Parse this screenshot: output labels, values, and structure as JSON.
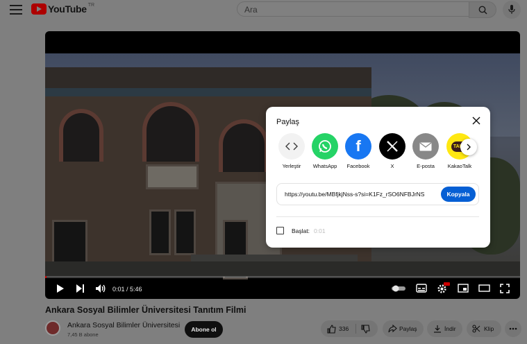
{
  "header": {
    "logo_text": "YouTube",
    "country_code": "TR",
    "search_placeholder": "Ara"
  },
  "player": {
    "time_display": "0:01 / 5:46",
    "progress_fraction": 0.003
  },
  "share_dialog": {
    "title": "Paylaş",
    "items": [
      {
        "label": "Yerleştir",
        "icon": "embed-icon",
        "color": "#f2f2f2"
      },
      {
        "label": "WhatsApp",
        "icon": "whatsapp-icon",
        "color": "#25d366"
      },
      {
        "label": "Facebook",
        "icon": "facebook-icon",
        "color": "#1877f2"
      },
      {
        "label": "X",
        "icon": "x-icon",
        "color": "#000000"
      },
      {
        "label": "E-posta",
        "icon": "email-icon",
        "color": "#888888"
      },
      {
        "label": "KakaoTalk",
        "icon": "kakaotalk-icon",
        "color": "#ffe812"
      }
    ],
    "kakao_badge": "TALK",
    "link": "https://youtu.be/MBfjkjNss-s?si=K1Fz_rSO6NFBJrNS",
    "copy_label": "Kopyala",
    "start_label": "Başlat:",
    "start_time": "0:01"
  },
  "video": {
    "title": "Ankara Sosyal Bilimler Üniversitesi Tanıtım Filmi",
    "channel_name": "Ankara Sosyal Bilimler Üniversitesi",
    "subscribers": "7,45 B abone",
    "subscribe_label": "Abone ol",
    "like_count": "336",
    "share_label": "Paylaş",
    "download_label": "İndir",
    "clip_label": "Klip"
  }
}
